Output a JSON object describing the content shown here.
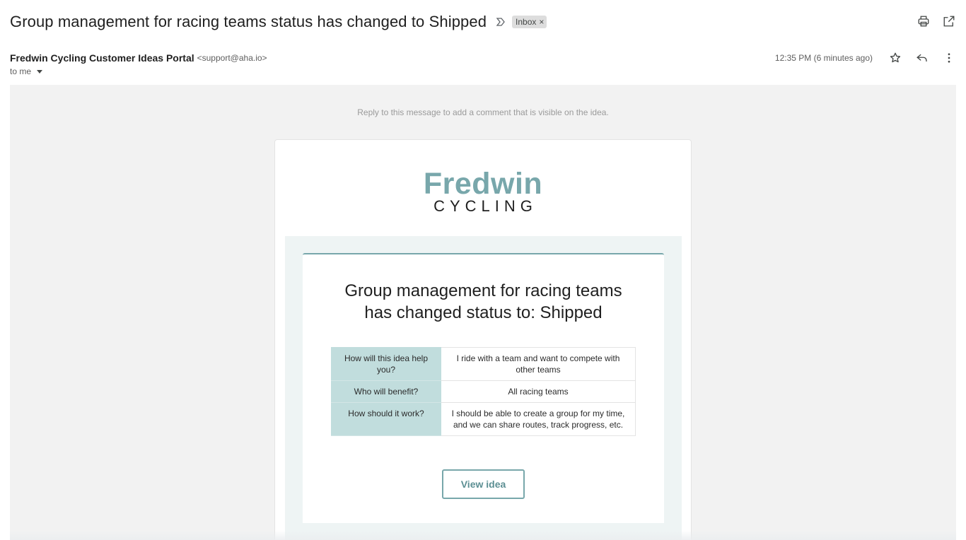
{
  "subject": {
    "title": "Group management for racing teams status has changed to Shipped",
    "label": "Inbox",
    "label_remove": "×"
  },
  "toolbar": {
    "print_icon": "printer-icon",
    "open_new_window_icon": "open-in-new-icon"
  },
  "message": {
    "sender_name": "Fredwin Cycling Customer Ideas Portal",
    "sender_email": "<support@aha.io>",
    "recipient": "to me",
    "timestamp": "12:35 PM (6 minutes ago)",
    "star_icon": "star-icon",
    "reply_icon": "reply-icon",
    "more_icon": "more-vert-icon"
  },
  "email_body": {
    "reply_note": "Reply to this message to add a comment that is visible on the idea.",
    "logo_main": "Fredwin",
    "logo_sub": "CYCLING",
    "status_heading_line1": "Group management for racing teams",
    "status_heading_line2": "has changed status to: Shipped",
    "details": [
      {
        "question": "How will this idea help you?",
        "answer": "I ride with a team and want to compete with other teams"
      },
      {
        "question": "Who will benefit?",
        "answer": "All racing teams"
      },
      {
        "question": "How should it work?",
        "answer": "I should be able to create a group for my time, and we can share routes, track progress, etc."
      }
    ],
    "view_button": "View idea"
  },
  "colors": {
    "brand_teal": "#78a7ab",
    "table_header_bg": "#c1dddd",
    "canvas_bg": "#f2f2f2",
    "panel_bg": "#eef4f4"
  }
}
